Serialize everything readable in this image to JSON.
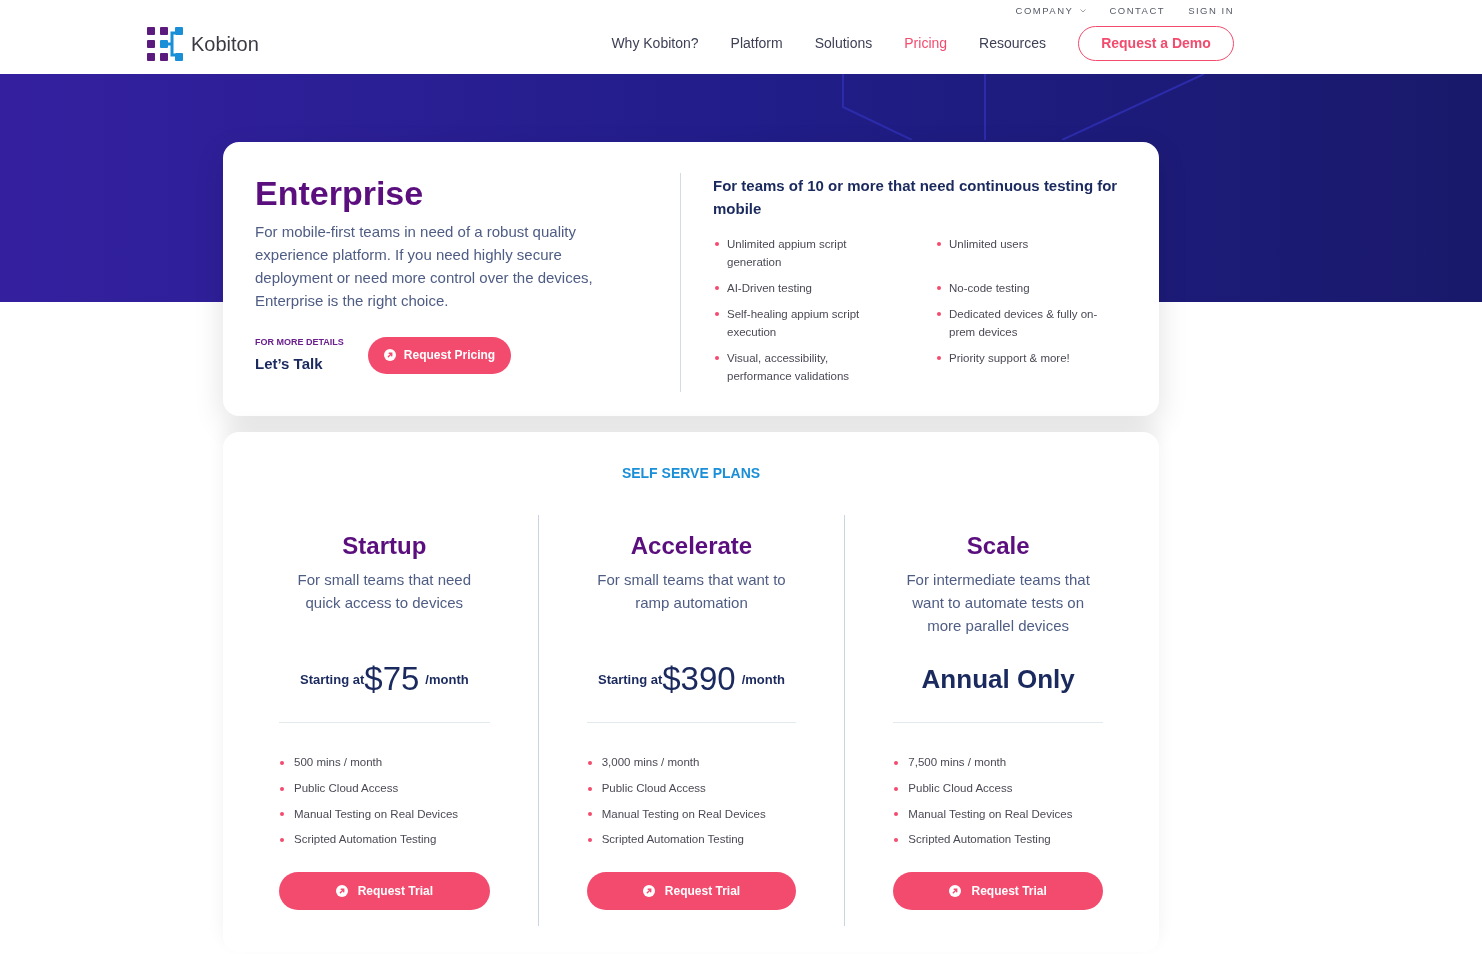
{
  "header": {
    "logo": {
      "text": "Kobiton"
    },
    "utility_links": [
      {
        "label": "COMPANY",
        "has_menu": true
      },
      {
        "label": "CONTACT",
        "has_menu": false
      },
      {
        "label": "SIGN IN",
        "has_menu": false
      }
    ],
    "nav": [
      {
        "label": "Why Kobiton?",
        "selected": false
      },
      {
        "label": "Platform",
        "selected": false
      },
      {
        "label": "Solutions",
        "selected": false
      },
      {
        "label": "Pricing",
        "selected": true
      },
      {
        "label": "Resources",
        "selected": false
      }
    ],
    "cta": "Request a Demo"
  },
  "enterprise": {
    "title": "Enterprise",
    "description": "For mobile-first teams in need of a robust quality experience platform. If you need highly secure deployment or need more control over the devices, Enterprise is the right choice.",
    "details_label": "FOR MORE DETAILS",
    "details_heading": "Let’s Talk",
    "button": "Request Pricing",
    "features_heading": "For teams of 10 or more that need continuous testing for mobile",
    "features": [
      "Unlimited appium script generation",
      "Unlimited users",
      "AI-Driven testing",
      "No-code testing",
      "Self-healing appium script execution",
      "Dedicated devices & fully on-prem devices",
      "Visual, accessibility, performance validations",
      "Priority support & more!"
    ]
  },
  "self_serve": {
    "heading": "SELF SERVE PLANS",
    "plans": [
      {
        "name": "Startup",
        "description": "For small teams that need quick access to devices",
        "price": {
          "kind": "amount",
          "prefix": "Starting at",
          "amount": "$75",
          "suffix": "/month"
        },
        "features": [
          "500 mins / month",
          "Public Cloud Access",
          "Manual Testing on Real Devices",
          "Scripted Automation Testing"
        ],
        "button": "Request Trial"
      },
      {
        "name": "Accelerate",
        "description": "For small teams that want to ramp automation",
        "price": {
          "kind": "amount",
          "prefix": "Starting at",
          "amount": "$390",
          "suffix": "/month"
        },
        "features": [
          "3,000 mins / month",
          "Public Cloud Access",
          "Manual Testing on Real Devices",
          "Scripted Automation Testing"
        ],
        "button": "Request Trial"
      },
      {
        "name": "Scale",
        "description": "For intermediate teams that want to automate tests on more parallel devices",
        "price": {
          "kind": "label",
          "text": "Annual Only"
        },
        "features": [
          "7,500 mins / month",
          "Public Cloud Access",
          "Manual Testing on Real Devices",
          "Scripted Automation Testing"
        ],
        "button": "Request Trial"
      }
    ]
  }
}
